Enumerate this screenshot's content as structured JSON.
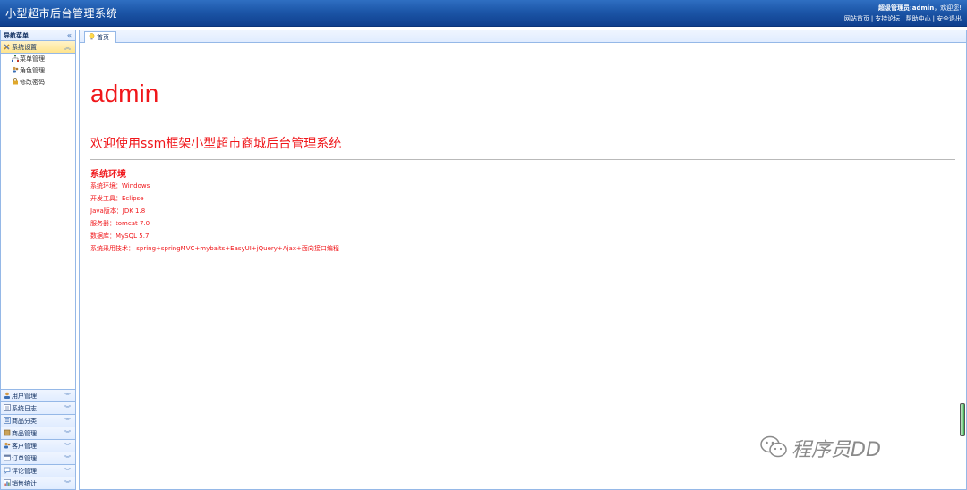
{
  "header": {
    "title": "小型超市后台管理系统",
    "welcome_prefix": "超级管理员:",
    "welcome_user": "admin",
    "welcome_suffix": "，欢迎您!",
    "links": [
      "网站首页",
      "支持论坛",
      "帮助中心",
      "安全退出"
    ]
  },
  "sidebar": {
    "nav_title": "导航菜单",
    "active_panel": {
      "label": "系统设置",
      "items": [
        "菜单管理",
        "角色管理",
        "修改密码"
      ]
    },
    "bottom_panels": [
      "用户管理",
      "系统日志",
      "商品分类",
      "商品管理",
      "客户管理",
      "订单管理",
      "评论管理",
      "销售统计"
    ]
  },
  "tabs": [
    {
      "label": "首页"
    }
  ],
  "content": {
    "heading": "admin",
    "welcome": "欢迎使用ssm框架小型超市商城后台管理系统",
    "env_title": "系统环境",
    "env_lines": [
      "系统环境：Windows",
      "开发工具：Eclipse",
      "Java版本：JDK 1.8",
      "服务器：tomcat 7.0",
      "数据库：MySQL 5.7",
      "系统采用技术：  spring+springMVC+mybaits+EasyUI+jQuery+Ajax+面向接口编程"
    ]
  },
  "watermark": "程序员DD",
  "colors": {
    "accent_red": "#f0161a",
    "header_blue": "#1c56a8",
    "border_blue": "#95b8e7",
    "active_panel": "#ffe48d"
  }
}
